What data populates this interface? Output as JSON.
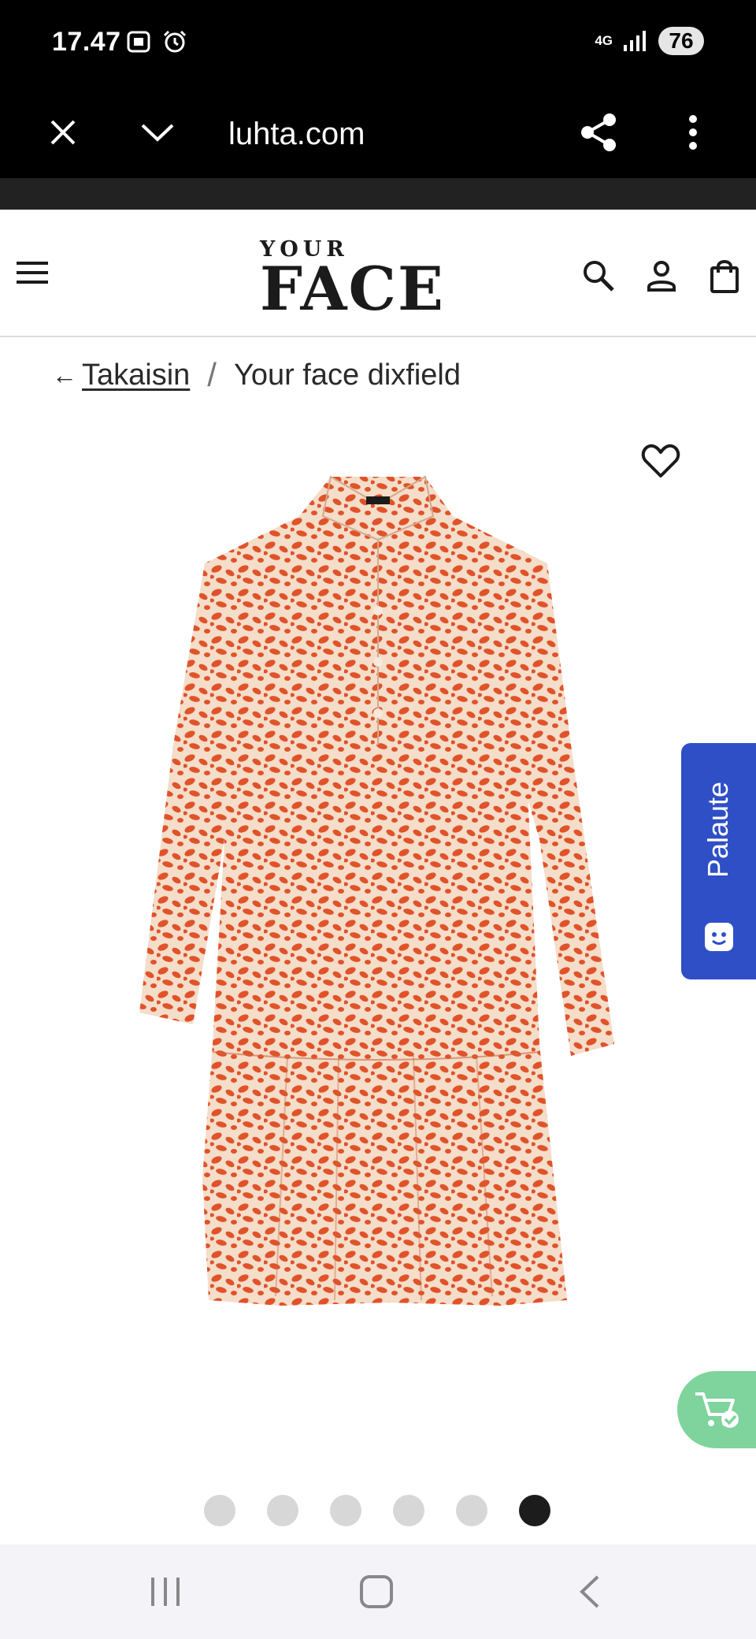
{
  "status_bar": {
    "time": "17.47",
    "network": "4G",
    "battery": "76"
  },
  "browser": {
    "url": "luhta.com"
  },
  "header": {
    "logo_top": "YOUR",
    "logo_bottom": "FACE"
  },
  "breadcrumb": {
    "back_arrow": "←",
    "back_label": "Takaisin",
    "separator": "/",
    "current": "Your face dixfield"
  },
  "product": {
    "dress_color": "#e0532a",
    "dress_bg_color": "#f4ddc9"
  },
  "feedback": {
    "label": "Palaute",
    "color": "#2f4fc7"
  },
  "float_cart": {
    "color": "#7ed49c"
  },
  "gallery": {
    "count": 6,
    "active_index": 5
  }
}
